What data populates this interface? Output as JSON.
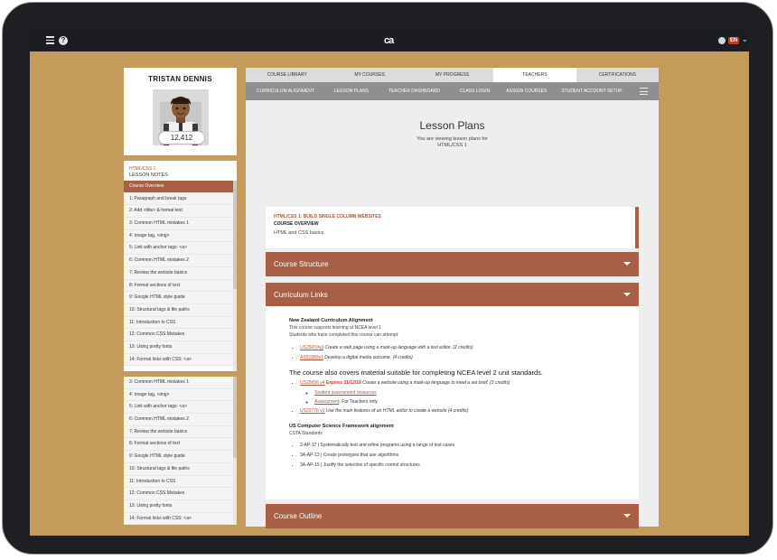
{
  "topbar": {
    "logo": "ca",
    "language": "EN"
  },
  "profile": {
    "name": "TRISTAN DENNIS",
    "score": "12,412"
  },
  "lesson_notes": {
    "course": "HTML/CSS 1",
    "heading": "LESSON NOTES",
    "items": [
      "Course Overview",
      "1: Paragraph and break tags",
      "2: Add <title> & format text",
      "3: Common HTML mistakes 1",
      "4: Image tag, <img>",
      "5: Link with anchor tags: <a>",
      "6: Common HTML mistakes 2",
      "7: Review the website basics",
      "8: Format sections of text",
      "9: Google HTML style guide",
      "10: Structural tags & file paths",
      "11: Introduction to CSS",
      "12: Common CSS Mistakes",
      "13: Using pretty fonts",
      "14: Format links with CSS: <a>"
    ],
    "items_second": [
      "3: Common HTML mistakes 1",
      "4: Image tag, <img>",
      "5: Link with anchor tags: <a>",
      "6: Common HTML mistakes 2",
      "7: Review the website basics",
      "8: Format sections of text",
      "9: Google HTML style guide",
      "10: Structural tags & file paths",
      "11: Introduction to CSS",
      "12: Common CSS Mistakes",
      "13: Using pretty fonts",
      "14: Format links with CSS: <a>"
    ]
  },
  "tabs": [
    "COURSE LIBRARY",
    "MY COURSES",
    "MY PROGRESS",
    "TEACHERS",
    "CERTIFICATIONS"
  ],
  "subnav": [
    "CURRICULUM ALIGNMENT",
    "LESSON PLANS",
    "TEACHER DASHBOARD",
    "CLASS LOGIN",
    "ASSIGN COURSES",
    "STUDENT ACCOUNT SETUP"
  ],
  "page": {
    "title": "Lesson Plans",
    "sub1": "You are viewing lesson plans for",
    "sub2": "HTML/CSS 1"
  },
  "overview": {
    "course": "HTML/CSS 1: BUILD SINGLE COLUMN WEBSITES",
    "title": "COURSE OVERVIEW",
    "desc": "HTML and CSS basics"
  },
  "accordions": {
    "structure": "Course Structure",
    "links": "Curriculum Links",
    "outline": "Course Outline"
  },
  "curriculum": {
    "nz_heading": "New Zealand Curriculum Alignment",
    "nz_line1": "This course supports learning at NCEA level 1",
    "nz_line2": "Students who have completed this course can attempt:",
    "nz_items": [
      {
        "code": "US25659v3",
        "text": "Create a web page using a mark-up language with a text editor. (2 credits)"
      },
      {
        "code": "AS91880v1",
        "text": "Develop a digital media outcome. (4 credits)"
      }
    ],
    "l2_heading": "The course also covers material suitable for completing NCEA level 2 unit standards.",
    "l2_item1_code": "US25656 v4",
    "l2_item1_expiry": "Expires 31/12/19",
    "l2_item1_text": "Create a website using a mark-up language to meet a set brief. (3 credits)",
    "l2_sub1": "Student assessment resources",
    "l2_sub2_link": "Assessment",
    "l2_sub2_text": "- For Teachers only",
    "l2_item2_code": "US29776 v1",
    "l2_item2_text": "Use the main features of an HTML editor to create a website (4 credits)",
    "us_heading": "US Computer Science Framework alignment",
    "us_sub": "CSTA Standards",
    "us_items": [
      "2-AP-17 | Systematically test and refine programs using a range of test cases",
      "3A-AP-13 | Create prototypes that use algorithms",
      "3A-AP-15 | Justify the selection of specific control structures"
    ]
  }
}
